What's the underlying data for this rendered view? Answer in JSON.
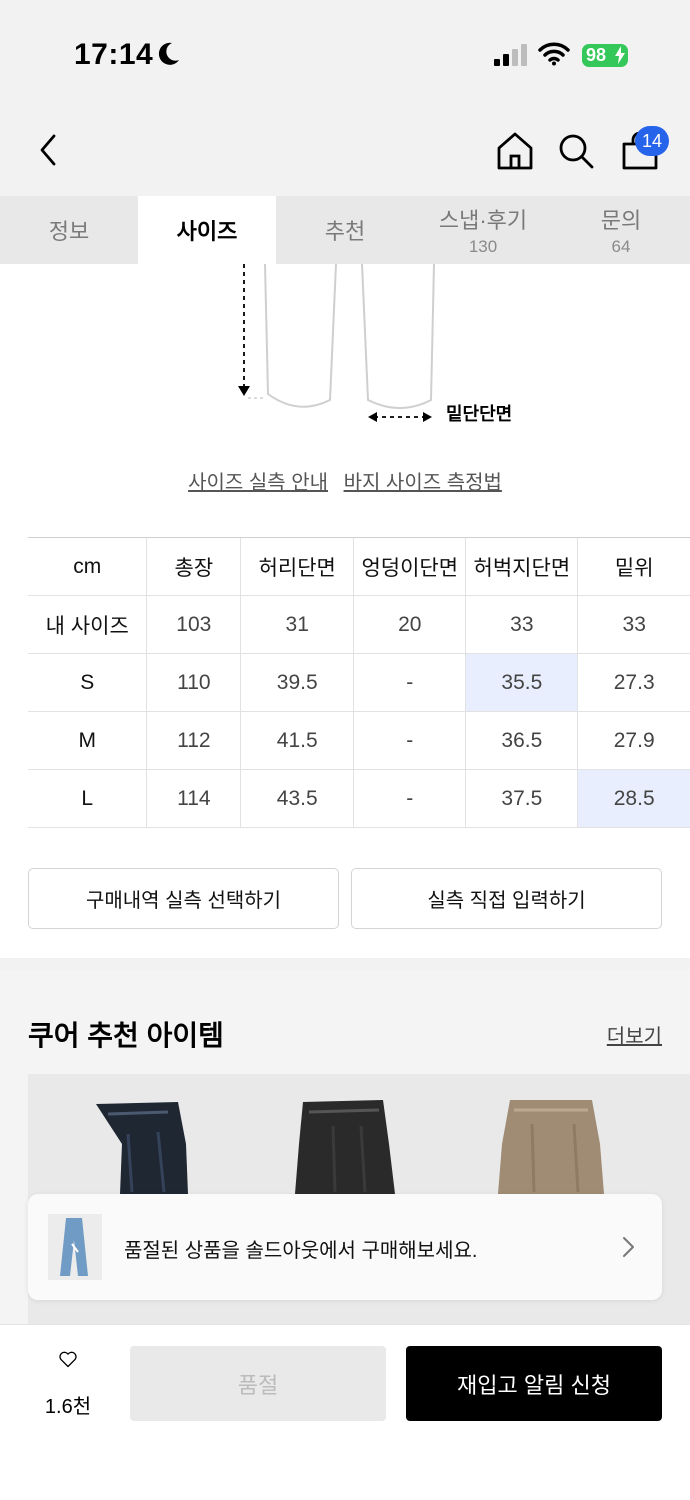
{
  "status_bar": {
    "time": "17:14",
    "battery": "98"
  },
  "header": {
    "cart_count": "14"
  },
  "tabs": [
    {
      "label": "정보",
      "count": ""
    },
    {
      "label": "사이즈",
      "count": ""
    },
    {
      "label": "추천",
      "count": ""
    },
    {
      "label": "스냅·후기",
      "count": "130"
    },
    {
      "label": "문의",
      "count": "64"
    }
  ],
  "diagram": {
    "hem_label": "밑단단면"
  },
  "guides": {
    "measure_guide": "사이즈 실측 안내",
    "pants_method": "바지 사이즈 측정법"
  },
  "size_table": {
    "headers": [
      "cm",
      "총장",
      "허리단면",
      "엉덩이단면",
      "허벅지단면",
      "밑위"
    ],
    "rows": [
      [
        "내 사이즈",
        "103",
        "31",
        "20",
        "33",
        "33"
      ],
      [
        "S",
        "110",
        "39.5",
        "-",
        "35.5",
        "27.3"
      ],
      [
        "M",
        "112",
        "41.5",
        "-",
        "36.5",
        "27.9"
      ],
      [
        "L",
        "114",
        "43.5",
        "-",
        "37.5",
        "28.5"
      ]
    ]
  },
  "actions": {
    "history_select": "구매내역 실측 선택하기",
    "direct_input": "실측 직접 입력하기"
  },
  "recommend": {
    "title": "쿠어 추천 아이템",
    "more": "더보기"
  },
  "toast": {
    "text": "품절된 상품을 솔드아웃에서 구매해보세요."
  },
  "bottom": {
    "like_count": "1.6천",
    "soldout": "품절",
    "restock": "재입고 알림 신청"
  },
  "colors": {
    "highlight": "#e8eefd",
    "badge": "#2563eb",
    "battery": "#34c759"
  }
}
